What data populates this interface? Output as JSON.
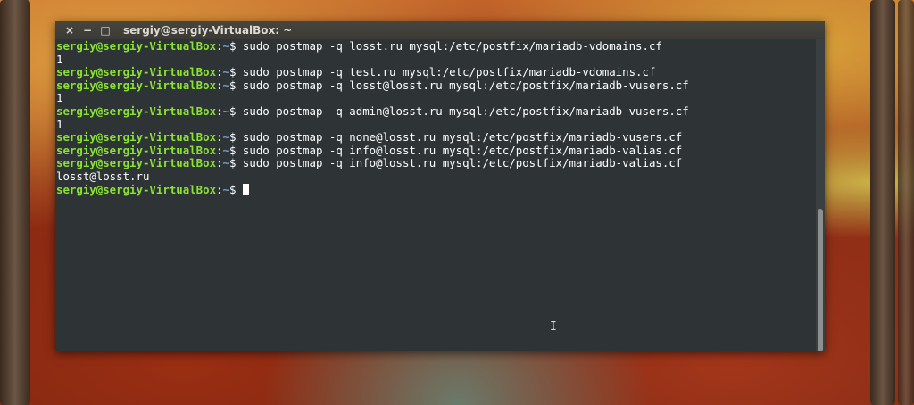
{
  "window": {
    "title": "sergiy@sergiy-VirtualBox: ~",
    "buttons": {
      "close": "×",
      "minimize": "−",
      "maximize": "□"
    }
  },
  "prompt": {
    "user_host": "sergiy@sergiy-VirtualBox",
    "colon": ":",
    "path": "~",
    "symbol": "$"
  },
  "lines": [
    {
      "type": "cmd",
      "text": " sudo postmap -q losst.ru mysql:/etc/postfix/mariadb-vdomains.cf"
    },
    {
      "type": "out",
      "text": "1"
    },
    {
      "type": "cmd",
      "text": " sudo postmap -q test.ru mysql:/etc/postfix/mariadb-vdomains.cf"
    },
    {
      "type": "cmd",
      "text": " sudo postmap -q losst@losst.ru mysql:/etc/postfix/mariadb-vusers.cf"
    },
    {
      "type": "out",
      "text": "1"
    },
    {
      "type": "cmd",
      "text": " sudo postmap -q admin@losst.ru mysql:/etc/postfix/mariadb-vusers.cf"
    },
    {
      "type": "out",
      "text": "1"
    },
    {
      "type": "cmd",
      "text": " sudo postmap -q none@losst.ru mysql:/etc/postfix/mariadb-vusers.cf"
    },
    {
      "type": "cmd",
      "text": " sudo postmap -q info@losst.ru mysql:/etc/postfix/mariadb-valias.cf"
    },
    {
      "type": "cmd",
      "text": " sudo postmap -q info@losst.ru mysql:/etc/postfix/mariadb-valias.cf"
    },
    {
      "type": "out",
      "text": "losst@losst.ru"
    },
    {
      "type": "cmd",
      "text": " "
    }
  ],
  "colors": {
    "terminal_bg": "#2e3436",
    "user_green": "#8ae234",
    "path_blue": "#729fcf",
    "titlebar": "#3c3b37"
  },
  "icons": {
    "text_cursor": "I"
  }
}
